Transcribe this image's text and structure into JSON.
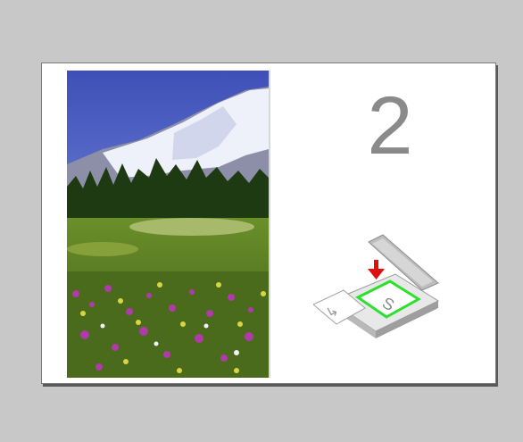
{
  "step": {
    "number": "2"
  },
  "illustration": {
    "photo_icon": "mountain-meadow-photo",
    "scanner_icon": "flatbed-scanner-icon",
    "arrow_icon": "placement-arrow-icon"
  },
  "colors": {
    "background": "#c8c8c8",
    "page": "#ffffff",
    "number": "#8a8a8a",
    "highlight": "#2ee02e",
    "arrow": "#e01010"
  }
}
